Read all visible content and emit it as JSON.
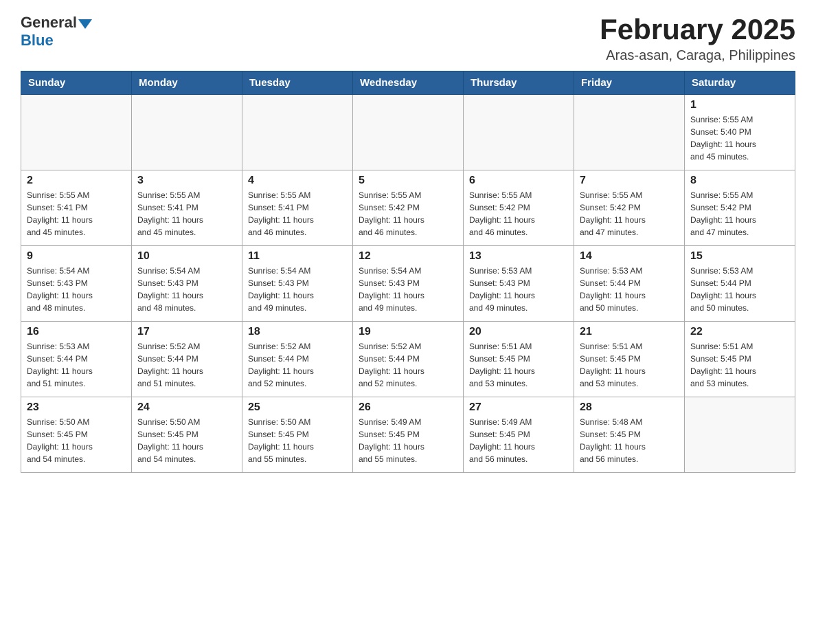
{
  "header": {
    "month_title": "February 2025",
    "location": "Aras-asan, Caraga, Philippines",
    "logo_general": "General",
    "logo_blue": "Blue"
  },
  "days_of_week": [
    "Sunday",
    "Monday",
    "Tuesday",
    "Wednesday",
    "Thursday",
    "Friday",
    "Saturday"
  ],
  "weeks": [
    [
      {
        "day": "",
        "info": ""
      },
      {
        "day": "",
        "info": ""
      },
      {
        "day": "",
        "info": ""
      },
      {
        "day": "",
        "info": ""
      },
      {
        "day": "",
        "info": ""
      },
      {
        "day": "",
        "info": ""
      },
      {
        "day": "1",
        "info": "Sunrise: 5:55 AM\nSunset: 5:40 PM\nDaylight: 11 hours\nand 45 minutes."
      }
    ],
    [
      {
        "day": "2",
        "info": "Sunrise: 5:55 AM\nSunset: 5:41 PM\nDaylight: 11 hours\nand 45 minutes."
      },
      {
        "day": "3",
        "info": "Sunrise: 5:55 AM\nSunset: 5:41 PM\nDaylight: 11 hours\nand 45 minutes."
      },
      {
        "day": "4",
        "info": "Sunrise: 5:55 AM\nSunset: 5:41 PM\nDaylight: 11 hours\nand 46 minutes."
      },
      {
        "day": "5",
        "info": "Sunrise: 5:55 AM\nSunset: 5:42 PM\nDaylight: 11 hours\nand 46 minutes."
      },
      {
        "day": "6",
        "info": "Sunrise: 5:55 AM\nSunset: 5:42 PM\nDaylight: 11 hours\nand 46 minutes."
      },
      {
        "day": "7",
        "info": "Sunrise: 5:55 AM\nSunset: 5:42 PM\nDaylight: 11 hours\nand 47 minutes."
      },
      {
        "day": "8",
        "info": "Sunrise: 5:55 AM\nSunset: 5:42 PM\nDaylight: 11 hours\nand 47 minutes."
      }
    ],
    [
      {
        "day": "9",
        "info": "Sunrise: 5:54 AM\nSunset: 5:43 PM\nDaylight: 11 hours\nand 48 minutes."
      },
      {
        "day": "10",
        "info": "Sunrise: 5:54 AM\nSunset: 5:43 PM\nDaylight: 11 hours\nand 48 minutes."
      },
      {
        "day": "11",
        "info": "Sunrise: 5:54 AM\nSunset: 5:43 PM\nDaylight: 11 hours\nand 49 minutes."
      },
      {
        "day": "12",
        "info": "Sunrise: 5:54 AM\nSunset: 5:43 PM\nDaylight: 11 hours\nand 49 minutes."
      },
      {
        "day": "13",
        "info": "Sunrise: 5:53 AM\nSunset: 5:43 PM\nDaylight: 11 hours\nand 49 minutes."
      },
      {
        "day": "14",
        "info": "Sunrise: 5:53 AM\nSunset: 5:44 PM\nDaylight: 11 hours\nand 50 minutes."
      },
      {
        "day": "15",
        "info": "Sunrise: 5:53 AM\nSunset: 5:44 PM\nDaylight: 11 hours\nand 50 minutes."
      }
    ],
    [
      {
        "day": "16",
        "info": "Sunrise: 5:53 AM\nSunset: 5:44 PM\nDaylight: 11 hours\nand 51 minutes."
      },
      {
        "day": "17",
        "info": "Sunrise: 5:52 AM\nSunset: 5:44 PM\nDaylight: 11 hours\nand 51 minutes."
      },
      {
        "day": "18",
        "info": "Sunrise: 5:52 AM\nSunset: 5:44 PM\nDaylight: 11 hours\nand 52 minutes."
      },
      {
        "day": "19",
        "info": "Sunrise: 5:52 AM\nSunset: 5:44 PM\nDaylight: 11 hours\nand 52 minutes."
      },
      {
        "day": "20",
        "info": "Sunrise: 5:51 AM\nSunset: 5:45 PM\nDaylight: 11 hours\nand 53 minutes."
      },
      {
        "day": "21",
        "info": "Sunrise: 5:51 AM\nSunset: 5:45 PM\nDaylight: 11 hours\nand 53 minutes."
      },
      {
        "day": "22",
        "info": "Sunrise: 5:51 AM\nSunset: 5:45 PM\nDaylight: 11 hours\nand 53 minutes."
      }
    ],
    [
      {
        "day": "23",
        "info": "Sunrise: 5:50 AM\nSunset: 5:45 PM\nDaylight: 11 hours\nand 54 minutes."
      },
      {
        "day": "24",
        "info": "Sunrise: 5:50 AM\nSunset: 5:45 PM\nDaylight: 11 hours\nand 54 minutes."
      },
      {
        "day": "25",
        "info": "Sunrise: 5:50 AM\nSunset: 5:45 PM\nDaylight: 11 hours\nand 55 minutes."
      },
      {
        "day": "26",
        "info": "Sunrise: 5:49 AM\nSunset: 5:45 PM\nDaylight: 11 hours\nand 55 minutes."
      },
      {
        "day": "27",
        "info": "Sunrise: 5:49 AM\nSunset: 5:45 PM\nDaylight: 11 hours\nand 56 minutes."
      },
      {
        "day": "28",
        "info": "Sunrise: 5:48 AM\nSunset: 5:45 PM\nDaylight: 11 hours\nand 56 minutes."
      },
      {
        "day": "",
        "info": ""
      }
    ]
  ]
}
